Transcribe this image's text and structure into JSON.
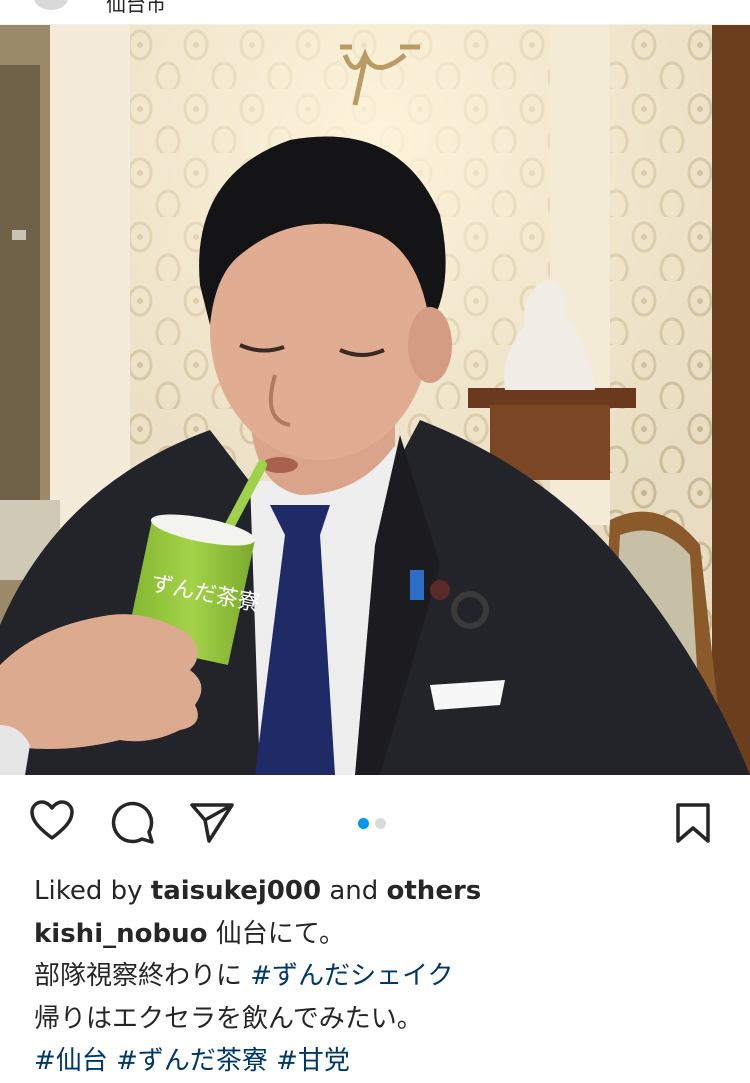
{
  "header": {
    "location": "仙台市"
  },
  "carousel": {
    "count": 2,
    "active_index": 0
  },
  "photo": {
    "cup_text": "ずんだ茶寮"
  },
  "actions": {
    "like_icon": "heart-icon",
    "comment_icon": "comment-icon",
    "share_icon": "send-icon",
    "save_icon": "bookmark-icon"
  },
  "likes": {
    "prefix": "Liked by",
    "user": "taisukej000",
    "conj": "and",
    "others": "others"
  },
  "caption": {
    "username": "kishi_nobuo",
    "line1": "仙台にて。",
    "line2_text": "部隊視察終わりに",
    "line2_tag": "#ずんだシェイク",
    "line3": "帰りはエクセラを飲んでみたい。",
    "hashtags": [
      "#仙台",
      "#ずんだ茶寮",
      "#甘党"
    ]
  },
  "colors": {
    "link": "#00376b",
    "accent_dot": "#0095f6",
    "text": "#262626"
  }
}
